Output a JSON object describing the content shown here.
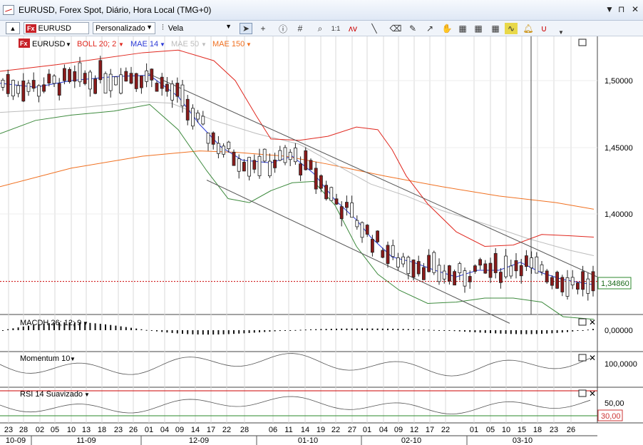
{
  "window": {
    "title": "EURUSD, Forex Spot, Diário, Hora Local (TMG+0)",
    "controls": [
      "▼",
      "⊓",
      "✕"
    ]
  },
  "toolbar": {
    "symbol": "EURUSD",
    "symbol_badge": "Fx",
    "layout": "Personalizado",
    "chart_type": "Vela",
    "icons": [
      "cursor-icon",
      "crosshair-icon",
      "info-icon",
      "grid-icon",
      "zoom-icon",
      "ratio-icon",
      "indicator-icon",
      "line-icon",
      "eraser-icon",
      "pencil-icon",
      "arrow-tool-icon",
      "hand-tool-icon",
      "template-icon-1",
      "template-icon-2",
      "template-icon-3",
      "template-icon-4",
      "alert-bell-icon",
      "magnet-icon"
    ]
  },
  "legend": {
    "symbol": "EURUSD",
    "indicators": [
      {
        "label": "BOLL 20; 2",
        "color": "#e0281f"
      },
      {
        "label": "MAE 14",
        "color": "#2a39d6"
      },
      {
        "label": "MAE 50",
        "color": "#bcbcbc"
      },
      {
        "label": "MAE 150",
        "color": "#f07020"
      }
    ]
  },
  "panes": {
    "macd_label": "MACDH 26; 12; 9",
    "momentum_label": "Momentum 10",
    "rsi_label": "RSI 14 Suavizado"
  },
  "price_axis": {
    "labels": [
      "1,50000",
      "1,45000",
      "1,40000"
    ],
    "current_price": "1,34860",
    "macd_label": "0,00000",
    "momentum_label": "100,0000",
    "rsi_labels": [
      "50,00",
      "30,00"
    ]
  },
  "time_axis": {
    "days": [
      "23",
      "28",
      "02",
      "05",
      "10",
      "13",
      "18",
      "23",
      "26",
      "01",
      "04",
      "09",
      "14",
      "17",
      "22",
      "28",
      "06",
      "11",
      "14",
      "19",
      "22",
      "27",
      "01",
      "04",
      "09",
      "12",
      "17",
      "22",
      "01",
      "05",
      "10",
      "15",
      "18",
      "23",
      "26"
    ],
    "months": [
      "10-09",
      "11-09",
      "12-09",
      "01-10",
      "02-10",
      "03-10"
    ]
  },
  "chart_data": {
    "type": "candlestick",
    "y_axis_ticks": [
      1.4,
      1.45,
      1.5
    ],
    "current_price": 1.3486,
    "indicators": [
      "BOLL 20; 2",
      "MAE 14",
      "MAE 50",
      "MAE 150",
      "MACDH 26; 12; 9",
      "Momentum 10",
      "RSI 14 Suavizado"
    ],
    "rsi_levels": [
      30,
      50
    ],
    "colors": {
      "up": "#1a1a1a",
      "down": "#8b1a1a",
      "boll": "#e0281f",
      "mae14": "#2a39d6",
      "mae50": "#bcbcbc",
      "mae150": "#f07020",
      "lower_band": "#3d8a3d"
    },
    "mae150": [
      [
        0,
        1.42
      ],
      [
        100,
        1.434
      ],
      [
        200,
        1.443
      ],
      [
        280,
        1.447
      ],
      [
        330,
        1.446
      ],
      [
        400,
        1.443
      ],
      [
        460,
        1.437
      ],
      [
        540,
        1.428
      ],
      [
        620,
        1.42
      ],
      [
        700,
        1.413
      ],
      [
        780,
        1.408
      ],
      [
        833,
        1.403
      ]
    ],
    "mae50": [
      [
        0,
        1.476
      ],
      [
        100,
        1.479
      ],
      [
        200,
        1.484
      ],
      [
        240,
        1.483
      ],
      [
        300,
        1.47
      ],
      [
        360,
        1.46
      ],
      [
        420,
        1.452
      ],
      [
        470,
        1.437
      ],
      [
        520,
        1.422
      ],
      [
        570,
        1.413
      ],
      [
        620,
        1.402
      ],
      [
        680,
        1.392
      ],
      [
        740,
        1.381
      ],
      [
        800,
        1.372
      ],
      [
        833,
        1.368
      ]
    ],
    "mae14": [
      [
        0,
        1.498
      ],
      [
        50,
        1.495
      ],
      [
        100,
        1.5
      ],
      [
        160,
        1.503
      ],
      [
        210,
        1.504
      ],
      [
        250,
        1.488
      ],
      [
        280,
        1.467
      ],
      [
        310,
        1.45
      ],
      [
        340,
        1.44
      ],
      [
        380,
        1.438
      ],
      [
        410,
        1.443
      ],
      [
        440,
        1.43
      ],
      [
        470,
        1.41
      ],
      [
        500,
        1.395
      ],
      [
        520,
        1.382
      ],
      [
        550,
        1.367
      ],
      [
        580,
        1.363
      ],
      [
        610,
        1.357
      ],
      [
        640,
        1.352
      ],
      [
        670,
        1.357
      ],
      [
        700,
        1.357
      ],
      [
        730,
        1.363
      ],
      [
        760,
        1.355
      ],
      [
        790,
        1.35
      ],
      [
        833,
        1.346
      ]
    ],
    "boll_upper": [
      [
        0,
        1.507
      ],
      [
        80,
        1.512
      ],
      [
        200,
        1.521
      ],
      [
        250,
        1.523
      ],
      [
        300,
        1.515
      ],
      [
        330,
        1.5
      ],
      [
        360,
        1.473
      ],
      [
        380,
        1.456
      ],
      [
        420,
        1.455
      ],
      [
        460,
        1.458
      ],
      [
        500,
        1.465
      ],
      [
        530,
        1.463
      ],
      [
        550,
        1.448
      ],
      [
        570,
        1.428
      ],
      [
        600,
        1.407
      ],
      [
        640,
        1.386
      ],
      [
        680,
        1.375
      ],
      [
        720,
        1.376
      ],
      [
        760,
        1.384
      ],
      [
        800,
        1.383
      ],
      [
        833,
        1.382
      ]
    ],
    "boll_lower": [
      [
        0,
        1.46
      ],
      [
        50,
        1.47
      ],
      [
        100,
        1.474
      ],
      [
        160,
        1.477
      ],
      [
        210,
        1.482
      ],
      [
        250,
        1.463
      ],
      [
        290,
        1.432
      ],
      [
        320,
        1.411
      ],
      [
        350,
        1.408
      ],
      [
        380,
        1.417
      ],
      [
        410,
        1.423
      ],
      [
        440,
        1.424
      ],
      [
        470,
        1.406
      ],
      [
        500,
        1.375
      ],
      [
        530,
        1.354
      ],
      [
        560,
        1.342
      ],
      [
        600,
        1.332
      ],
      [
        640,
        1.333
      ],
      [
        680,
        1.336
      ],
      [
        720,
        1.336
      ],
      [
        760,
        1.333
      ],
      [
        790,
        1.322
      ],
      [
        833,
        1.32
      ]
    ]
  }
}
